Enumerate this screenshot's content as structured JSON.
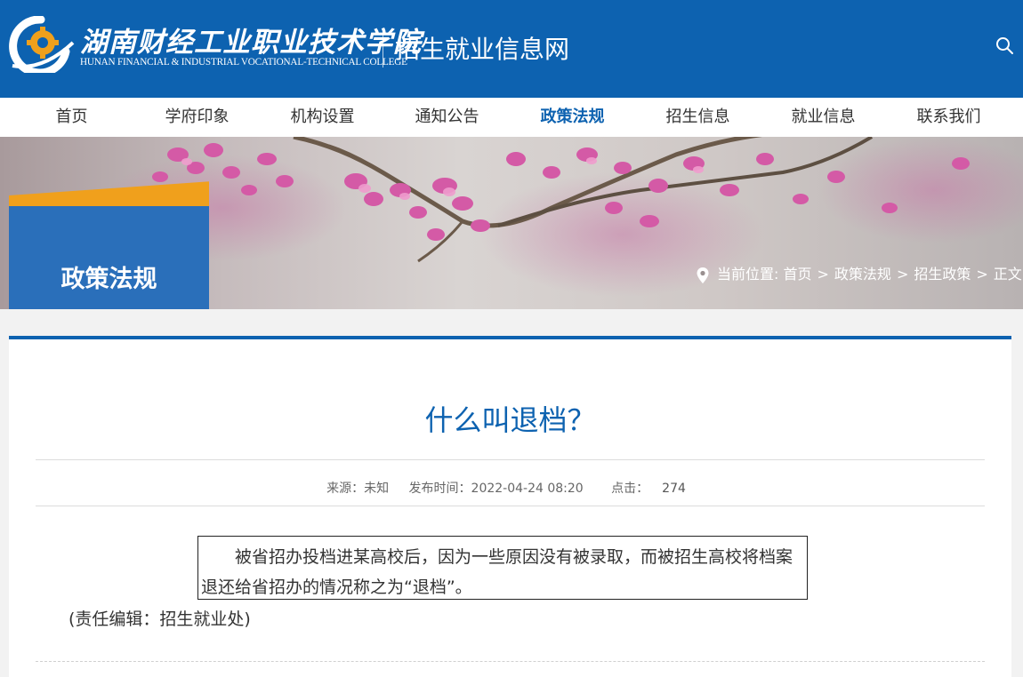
{
  "header": {
    "logo_cn": "湖南财经工业职业技术学院",
    "logo_en": "HUNAN FINANCIAL & INDUSTRIAL VOCATIONAL-TECHNICAL COLLEGE",
    "site_title": "招生就业信息网",
    "search_icon": "search-icon"
  },
  "nav": {
    "items": [
      {
        "label": "首页"
      },
      {
        "label": "学府印象"
      },
      {
        "label": "机构设置"
      },
      {
        "label": "通知公告"
      },
      {
        "label": "政策法规"
      },
      {
        "label": "招生信息"
      },
      {
        "label": "就业信息"
      },
      {
        "label": "联系我们"
      }
    ],
    "active": "政策法规"
  },
  "banner": {
    "title": "政策法规",
    "location_label": "当前位置:",
    "breadcrumb": [
      "首页",
      "政策法规",
      "招生政策",
      "正文"
    ],
    "separator": ">"
  },
  "article": {
    "title": "什么叫退档？",
    "source": "来源：未知",
    "publish_time": "发布时间：2022-04-24 08:20",
    "clicks_label": "点击：",
    "clicks_value": "274",
    "body": "被省招办投档进某高校后，因为一些原因没有被录取，而被招生高校将档案退还给省招办的情况称之为“退档”。",
    "editor": "(责任编辑：招生就业处)"
  },
  "colors": {
    "brand_blue": "#0d62b0",
    "accent_orange": "#f0a01c"
  }
}
